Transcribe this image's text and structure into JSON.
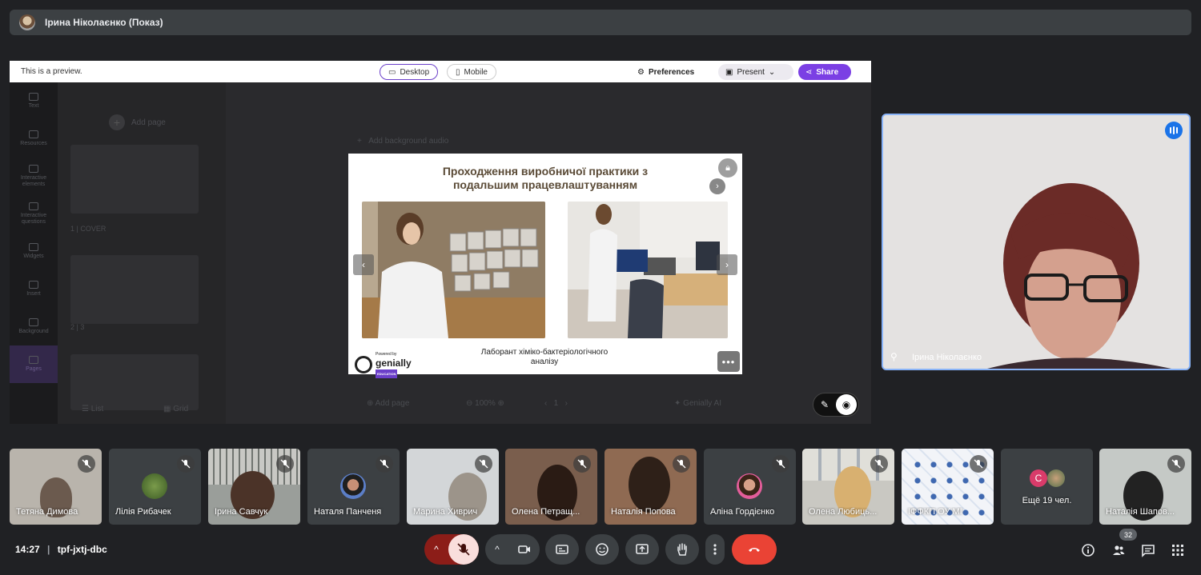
{
  "header": {
    "presenter_title": "Ірина Ніколаєнко (Показ)"
  },
  "preview_bar": {
    "notice": "This is a preview.",
    "desktop_label": "Desktop",
    "mobile_label": "Mobile",
    "preferences_label": "Preferences",
    "present_label": "Present",
    "share_label": "Share",
    "accent_color": "#7b3fe4"
  },
  "editor_sidebar": {
    "items": [
      "Text",
      "Resources",
      "Interactive elements",
      "Interactive questions",
      "Widgets",
      "Insert",
      "Background",
      "Pages"
    ]
  },
  "pages_panel": {
    "add_page": "Add page",
    "pages": [
      "1 | COVER",
      "2 | 3"
    ],
    "view_list": "List",
    "view_grid": "Grid"
  },
  "canvas": {
    "add_background_audio": "Add background audio",
    "footer_add_page": "Add page",
    "zoom": "100%",
    "page_number": "1",
    "genially_ai": "Genially AI"
  },
  "slide": {
    "title_line1": "Проходження виробничої практики з",
    "title_line2": "подальшим працевлаштуванням",
    "caption_line1": "Лаборант хіміко-бактеріологічного",
    "caption_line2": "аналізу",
    "brand_powered": "Powered by",
    "brand_name": "genially",
    "brand_edu": "EDUCATION"
  },
  "speaker": {
    "name": "Ірина Ніколаєнко"
  },
  "participants": [
    {
      "name": "Тетяна Димова"
    },
    {
      "name": "Лілія Рибачек"
    },
    {
      "name": "Ірина Савчук"
    },
    {
      "name": "Наталя Панченя"
    },
    {
      "name": "Марина Хиврич"
    },
    {
      "name": "Олена Петращ..."
    },
    {
      "name": "Наталія Попова"
    },
    {
      "name": "Аліна Гордієнко"
    },
    {
      "name": "Олена Любиць..."
    },
    {
      "name": "ІФФКП ОУ МІ"
    },
    {
      "name": "Ещё 19 чел."
    },
    {
      "name": "Наталія Шапов..."
    }
  ],
  "more_tile_avatar_letter": "C",
  "meeting": {
    "time": "14:27",
    "code": "tpf-jxtj-dbc",
    "people_count": "32"
  },
  "colors": {
    "end_call": "#ea4335",
    "mic_off": "#f9dedc",
    "speaker_border": "#8ab4f8"
  }
}
